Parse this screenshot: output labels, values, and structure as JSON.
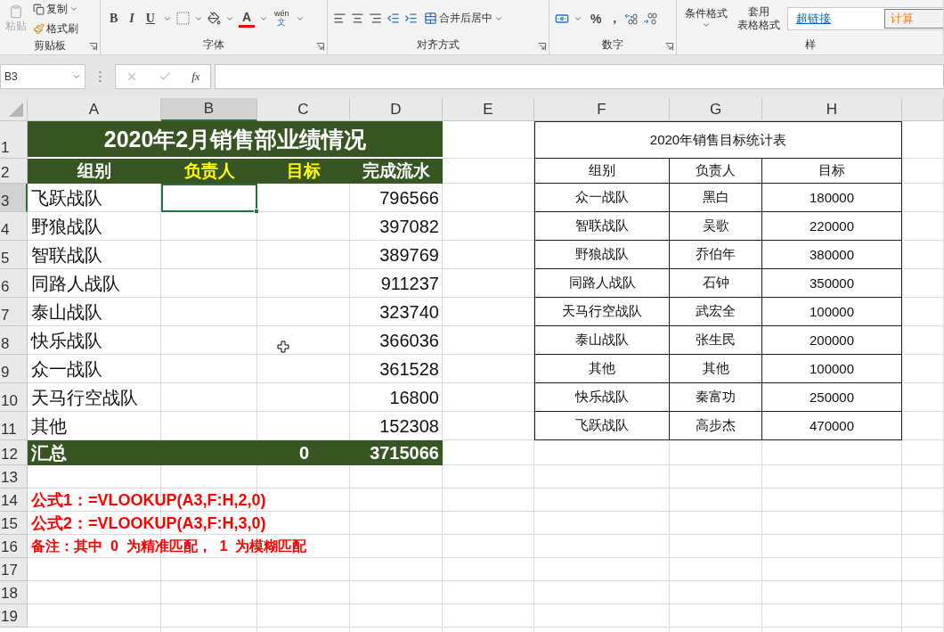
{
  "ribbon": {
    "groups": [
      {
        "kind": "clipboard",
        "label": "剪贴板",
        "paste": {
          "label": "粘贴",
          "disabled": true
        },
        "buttons": [
          "复制",
          "格式刷"
        ]
      },
      {
        "kind": "font",
        "label": "字体",
        "style_buttons": [
          "B",
          "I",
          "U"
        ],
        "font_color_glyph": "A",
        "phonetic": {
          "top": "wén",
          "bottom": "文"
        }
      },
      {
        "kind": "alignment",
        "label": "对齐方式",
        "merge": "合并后居中"
      },
      {
        "kind": "number",
        "label": "数字",
        "percent": "%",
        "comma": ","
      },
      {
        "kind": "styles",
        "label": "样",
        "conditional": "条件格式",
        "table_format": [
          "套用",
          "表格格式"
        ],
        "cell_styles": [
          {
            "label": "超链接",
            "kind": "link"
          },
          {
            "label": "计算",
            "kind": "calc"
          }
        ]
      }
    ]
  },
  "formula_bar": {
    "name_box": "B3",
    "fx": "fx"
  },
  "sheet": {
    "column_headers": [
      {
        "label": "A",
        "selected": false
      },
      {
        "label": "B",
        "selected": true
      },
      {
        "label": "C",
        "selected": false
      },
      {
        "label": "D",
        "selected": false
      },
      {
        "label": "E",
        "selected": false
      },
      {
        "label": "F",
        "selected": false
      },
      {
        "label": "G",
        "selected": false
      },
      {
        "label": "H",
        "selected": false
      }
    ],
    "row_headers": [
      {
        "label": "1",
        "selected": false
      },
      {
        "label": "2",
        "selected": false
      },
      {
        "label": "3",
        "selected": true
      },
      {
        "label": "4",
        "selected": false
      },
      {
        "label": "5",
        "selected": false
      },
      {
        "label": "6",
        "selected": false
      },
      {
        "label": "7",
        "selected": false
      },
      {
        "label": "8",
        "selected": false
      },
      {
        "label": "9",
        "selected": false
      },
      {
        "label": "10",
        "selected": false
      },
      {
        "label": "11",
        "selected": false
      },
      {
        "label": "12",
        "selected": false
      },
      {
        "label": "13",
        "selected": false
      },
      {
        "label": "14",
        "selected": false
      },
      {
        "label": "15",
        "selected": false
      },
      {
        "label": "16",
        "selected": false
      },
      {
        "label": "17",
        "selected": false
      },
      {
        "label": "18",
        "selected": false
      },
      {
        "label": "19",
        "selected": false
      }
    ],
    "report": {
      "title": "2020年2月销售部业绩情况",
      "headers": [
        {
          "label": "组别",
          "highlight": false
        },
        {
          "label": "负责人",
          "highlight": true
        },
        {
          "label": "目标",
          "highlight": true
        },
        {
          "label": "完成流水",
          "highlight": false
        }
      ],
      "rows": [
        {
          "group": "飞跃战队",
          "amount": "796566"
        },
        {
          "group": "野狼战队",
          "amount": "397082"
        },
        {
          "group": "智联战队",
          "amount": "389769"
        },
        {
          "group": "同路人战队",
          "amount": "911237"
        },
        {
          "group": "泰山战队",
          "amount": "323740"
        },
        {
          "group": "快乐战队",
          "amount": "366036"
        },
        {
          "group": "众一战队",
          "amount": "361528"
        },
        {
          "group": "天马行空战队",
          "amount": "16800"
        },
        {
          "group": "其他",
          "amount": "152308"
        }
      ],
      "total": {
        "label": "汇总",
        "target": "0",
        "amount": "3715066"
      }
    },
    "notes": [
      "公式1：=VLOOKUP(A3,F:H,2,0)",
      "公式2：=VLOOKUP(A3,F:H,3,0)",
      "备注：其中  0  为精准匹配，  1  为模糊匹配"
    ],
    "targets": {
      "title": "2020年销售目标统计表",
      "headers": [
        "组别",
        "负责人",
        "目标"
      ],
      "rows": [
        [
          "众一战队",
          "黑白",
          "180000"
        ],
        [
          "智联战队",
          "吴歌",
          "220000"
        ],
        [
          "野狼战队",
          "乔伯年",
          "380000"
        ],
        [
          "同路人战队",
          "石钟",
          "350000"
        ],
        [
          "天马行空战队",
          "武宏全",
          "100000"
        ],
        [
          "泰山战队",
          "张生民",
          "200000"
        ],
        [
          "其他",
          "其他",
          "100000"
        ],
        [
          "快乐战队",
          "秦富功",
          "250000"
        ],
        [
          "飞跃战队",
          "高步杰",
          "470000"
        ]
      ]
    }
  }
}
